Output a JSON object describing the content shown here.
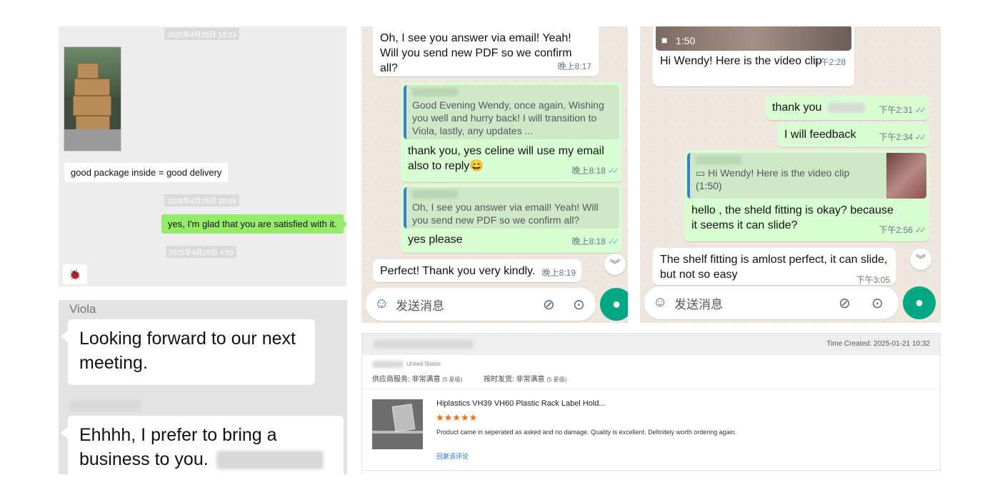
{
  "panel_a": {
    "timestamps": [
      "2025年4月25日 18:53",
      "2025年4月25日 20:59",
      "2025年4月26日 4:59"
    ],
    "messages": {
      "received_1": "good package inside = good delivery",
      "sent_1": "yes, I'm glad that you are satisfied with it."
    },
    "emoji": "🐞"
  },
  "panel_b": {
    "sender_1": "Viola",
    "message_1": "Looking forward to our next meeting.",
    "message_2": "Ehhhh, I prefer to bring a business to you."
  },
  "panel_c": {
    "messages": [
      {
        "text": "Oh, I see you answer via email! Yeah! Will you send new PDF so we confirm all?",
        "time": "晚上8:17"
      },
      {
        "quote": "Good Evening Wendy, once again, Wishing you well and hurry back! I will transition to Viola, lastly, any updates ...",
        "text": "thank you, yes celine will use my email also to reply😄",
        "time": "晚上8:18"
      },
      {
        "quote": "Oh, I see you answer via email! Yeah! Will you send new PDF so we confirm all?",
        "text": "yes please",
        "time": "晚上8:18"
      },
      {
        "text": "Perfect! Thank you very kindly.",
        "time": "晚上8:19"
      }
    ],
    "composer_placeholder": "发送消息"
  },
  "panel_d": {
    "video_duration": "1:50",
    "messages": [
      {
        "text": "Hi Wendy! Here is the video clip",
        "time": "下午2:28"
      },
      {
        "text": "thank you",
        "time": "下午2:31"
      },
      {
        "text": "I will feedback",
        "time": "下午2:34"
      },
      {
        "quote": "Hi Wendy! Here is the video clip (1:50)",
        "text": "hello , the sheld fitting is okay? because it seems it can slide?",
        "time": "下午2:56"
      },
      {
        "text": "The shelf fitting is amlost perfect, it can slide, but not so easy",
        "time": "下午3:05"
      }
    ],
    "composer_placeholder": "发送消息"
  },
  "panel_e": {
    "time_created": "Time Created: 2025-01-21 10:32",
    "country": "United States",
    "supplier_service_label": "供应商服务: 非常满意",
    "supplier_service_rating": "(5 星级)",
    "ontime_label": "按时发货: 非常满意",
    "ontime_rating": "(5 星级)",
    "product_title": "Hiplastics VH39 VH60 Plastic Rack Label Hold...",
    "stars": "★★★★★",
    "review_text": "Product came in seperated as asked and no damage. Quality is excellent. Definitely worth ordering again.",
    "reply_link": "回复该评论"
  },
  "colors": {
    "wechat_green": "#95ec69",
    "whatsapp_green_bubble": "#d9fdd3",
    "whatsapp_mic": "#00a884",
    "read_ticks": "#53bdeb",
    "star_orange": "#ff6a00",
    "link_blue": "#1a73e8"
  },
  "icons": [
    "emoji-icon",
    "attach-icon",
    "camera-icon",
    "mic-icon",
    "chevrons-down-icon",
    "video-icon"
  ]
}
